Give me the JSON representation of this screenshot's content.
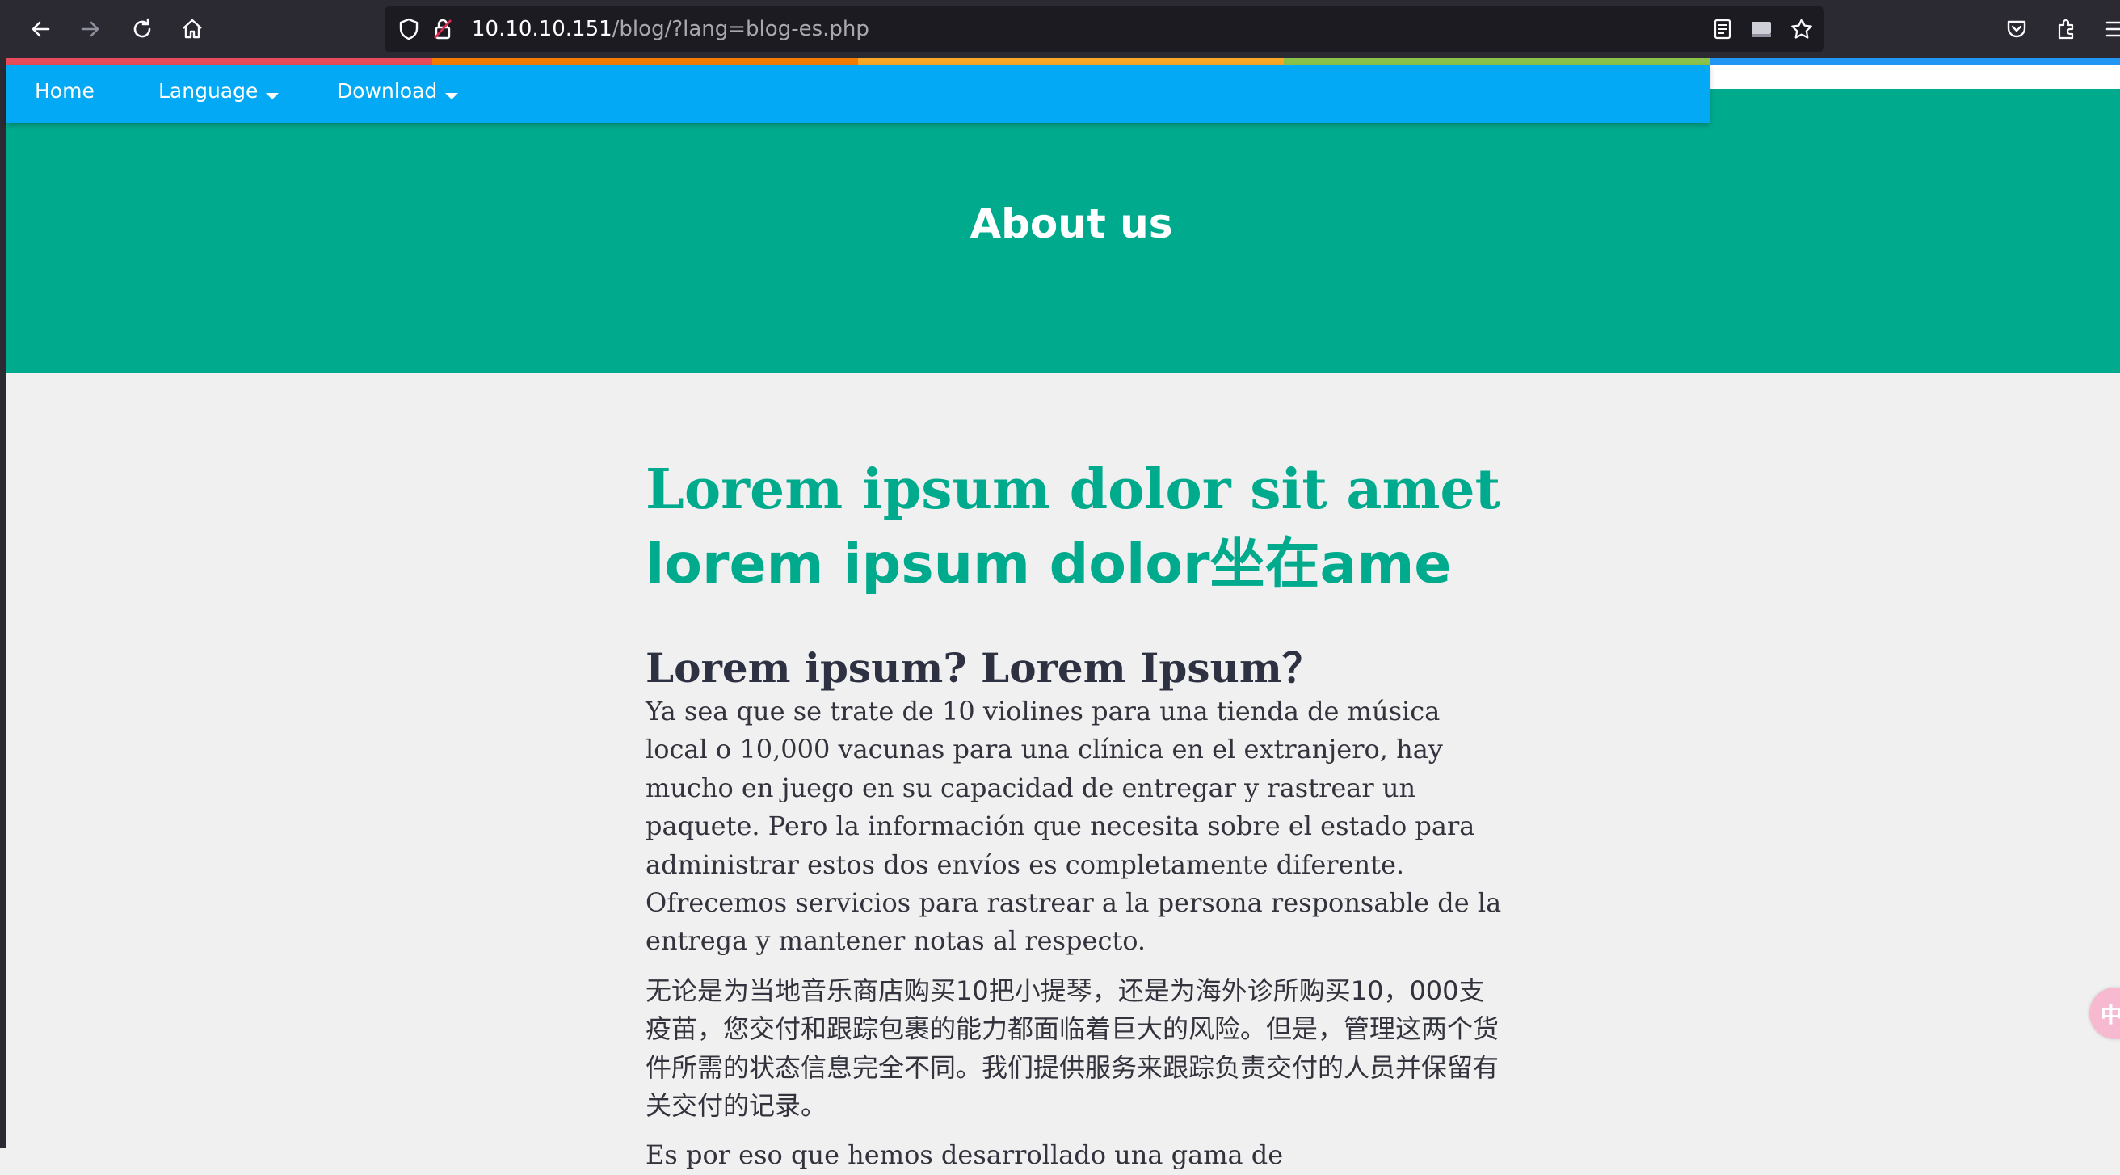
{
  "browser": {
    "url_host": "10.10.10.151",
    "url_path": "/blog/?lang=blog-es.php"
  },
  "nav": {
    "home": "Home",
    "language": "Language",
    "download": "Download",
    "bg_color": "#03a9f4",
    "rainbow_colors": [
      "#e84c5a",
      "#f57c00",
      "#f9a825",
      "#8bc34a"
    ]
  },
  "hero": {
    "title": "About us",
    "bg_color": "#00aa8d"
  },
  "article": {
    "heading_line1": "Lorem ipsum dolor sit amet",
    "heading_line2": "lorem ipsum dolor坐在ame",
    "subheading_a": "Lorem ipsum? Lorem Ipsum",
    "subheading_b": "？",
    "paragraph_es": "Ya sea que se trate de 10 violines para una tienda de música local o 10,000 vacunas para una clínica en el extranjero, hay mucho en juego en su capacidad de entregar y rastrear un paquete. Pero la información que necesita sobre el estado para administrar estos dos envíos es completamente diferente. Ofrecemos servicios para rastrear a la persona responsable de la entrega y mantener notas al respecto.",
    "paragraph_zh": "无论是为当地音乐商店购买10把小提琴，还是为海外诊所购买10，000支疫苗，您交付和跟踪包裹的能力都面临着巨大的风险。但是，管理这两个货件所需的状态信息完全不同。我们提供服务来跟踪负责交付的人员并保留有关交付的记录。",
    "paragraph_cut": "Es por eso que hemos desarrollado una gama de",
    "accent_color": "#00aa8d"
  },
  "widget": {
    "glyph": "中"
  }
}
